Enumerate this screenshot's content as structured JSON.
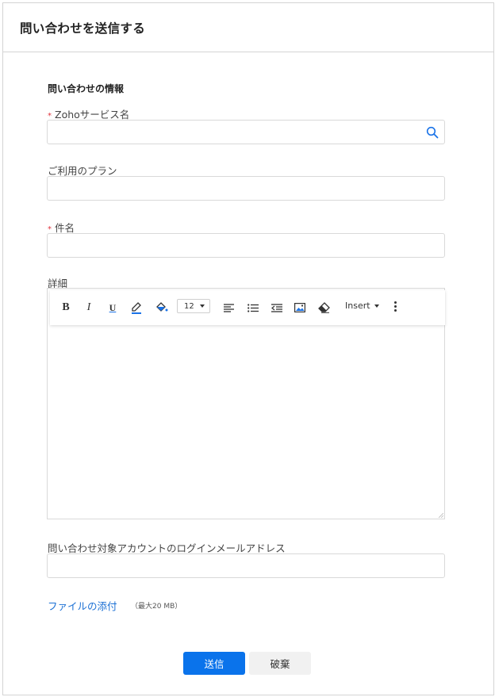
{
  "header": {
    "title": "問い合わせを送信する"
  },
  "form": {
    "section_title": "問い合わせの情報",
    "service": {
      "label": "Zohoサービス名",
      "required": true,
      "value": "",
      "placeholder": ""
    },
    "plan": {
      "label": "ご利用のプラン",
      "value": "",
      "placeholder": ""
    },
    "subject": {
      "label": "件名",
      "required": true,
      "value": "",
      "placeholder": ""
    },
    "details": {
      "label": "詳細",
      "toolbar": {
        "bold": "B",
        "italic": "I",
        "underline": "U",
        "font_size": "12",
        "insert_label": "Insert",
        "icons": [
          "highlight-icon",
          "fill-color-icon",
          "align-left-icon",
          "bullet-list-icon",
          "outdent-icon",
          "image-icon",
          "eraser-icon",
          "more-options-icon"
        ]
      }
    },
    "email": {
      "label": "問い合わせ対象アカウントのログインメールアドレス",
      "value": "",
      "placeholder": ""
    },
    "attach": {
      "label": "ファイルの添付",
      "note": "（最大20 MB）"
    }
  },
  "actions": {
    "submit": "送信",
    "discard": "破棄"
  },
  "colors": {
    "primary": "#0a73eb",
    "link": "#1a6fd4",
    "required": "#e0333d",
    "icon_blue": "#1a73e8"
  }
}
